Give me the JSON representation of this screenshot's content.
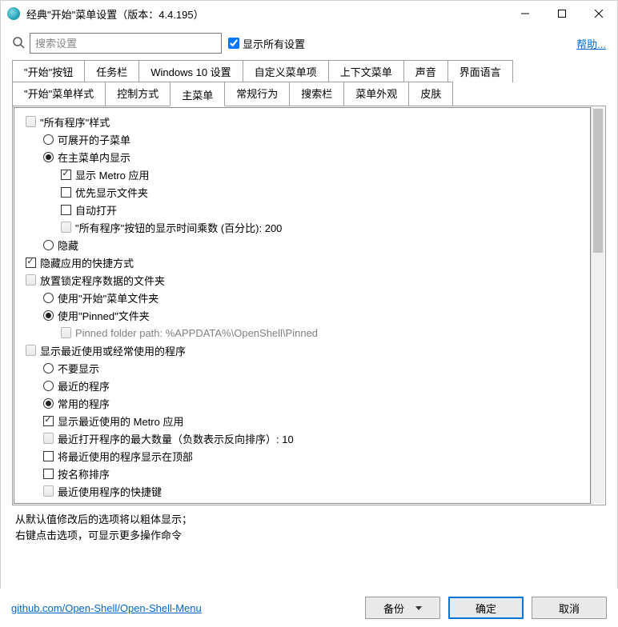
{
  "window": {
    "title": "经典\"开始\"菜单设置（版本：4.4.195）"
  },
  "toolbar": {
    "search_placeholder": "搜索设置",
    "show_all_label": "显示所有设置",
    "show_all_checked": true,
    "help_label": "帮助..."
  },
  "tabs": {
    "row1": [
      {
        "id": "start-button",
        "label": "\"开始\"按钮"
      },
      {
        "id": "taskbar",
        "label": "任务栏"
      },
      {
        "id": "win10-settings",
        "label": "Windows 10 设置"
      },
      {
        "id": "custom-menu-items",
        "label": "自定义菜单项"
      },
      {
        "id": "context-menu",
        "label": "上下文菜单"
      },
      {
        "id": "sound",
        "label": "声音"
      },
      {
        "id": "ui-language",
        "label": "界面语言"
      }
    ],
    "row2": [
      {
        "id": "start-menu-style",
        "label": "\"开始\"菜单样式"
      },
      {
        "id": "control-method",
        "label": "控制方式"
      },
      {
        "id": "main-menu",
        "label": "主菜单",
        "active": true
      },
      {
        "id": "general-behavior",
        "label": "常规行为"
      },
      {
        "id": "search-bar",
        "label": "搜索栏"
      },
      {
        "id": "menu-appearance",
        "label": "菜单外观"
      },
      {
        "id": "skin",
        "label": "皮肤"
      }
    ]
  },
  "tree": [
    {
      "kind": "heading",
      "indent": 0,
      "text": "\"所有程序\"样式"
    },
    {
      "kind": "radio",
      "indent": 1,
      "checked": false,
      "text": "可展开的子菜单"
    },
    {
      "kind": "radio",
      "indent": 1,
      "checked": true,
      "text": "在主菜单内显示"
    },
    {
      "kind": "check",
      "indent": 2,
      "checked": true,
      "text": "显示 Metro 应用"
    },
    {
      "kind": "check",
      "indent": 2,
      "checked": false,
      "text": "优先显示文件夹"
    },
    {
      "kind": "check",
      "indent": 2,
      "checked": false,
      "text": "自动打开"
    },
    {
      "kind": "value",
      "indent": 2,
      "text": "\"所有程序\"按钮的显示时间乘数 (百分比): 200"
    },
    {
      "kind": "radio",
      "indent": 1,
      "checked": false,
      "text": "隐藏"
    },
    {
      "kind": "check",
      "indent": 0,
      "checked": true,
      "text": "隐藏应用的快捷方式"
    },
    {
      "kind": "heading",
      "indent": 0,
      "text": "放置锁定程序数据的文件夹"
    },
    {
      "kind": "radio",
      "indent": 1,
      "checked": false,
      "text": "使用\"开始\"菜单文件夹"
    },
    {
      "kind": "radio",
      "indent": 1,
      "checked": true,
      "text": "使用\"Pinned\"文件夹"
    },
    {
      "kind": "value",
      "indent": 2,
      "disabled": true,
      "text": "Pinned folder path: %APPDATA%\\OpenShell\\Pinned"
    },
    {
      "kind": "heading",
      "indent": 0,
      "text": "显示最近使用或经常使用的程序"
    },
    {
      "kind": "radio",
      "indent": 1,
      "checked": false,
      "text": "不要显示"
    },
    {
      "kind": "radio",
      "indent": 1,
      "checked": false,
      "text": "最近的程序"
    },
    {
      "kind": "radio",
      "indent": 1,
      "checked": true,
      "text": "常用的程序"
    },
    {
      "kind": "check",
      "indent": 1,
      "checked": true,
      "text": "显示最近使用的 Metro 应用"
    },
    {
      "kind": "value",
      "indent": 1,
      "text": "最近打开程序的最大数量（负数表示反向排序）: 10"
    },
    {
      "kind": "check",
      "indent": 1,
      "checked": false,
      "text": "将最近使用的程序显示在顶部"
    },
    {
      "kind": "check",
      "indent": 1,
      "checked": false,
      "text": "按名称排序"
    },
    {
      "kind": "value",
      "indent": 1,
      "text": "最近使用程序的快捷键"
    }
  ],
  "hints": {
    "line1": "从默认值修改后的选项将以粗体显示；",
    "line2": "右键点击选项，可显示更多操作命令"
  },
  "footer": {
    "repo_link": "github.com/Open-Shell/Open-Shell-Menu",
    "backup_label": "备份",
    "ok_label": "确定",
    "cancel_label": "取消"
  }
}
